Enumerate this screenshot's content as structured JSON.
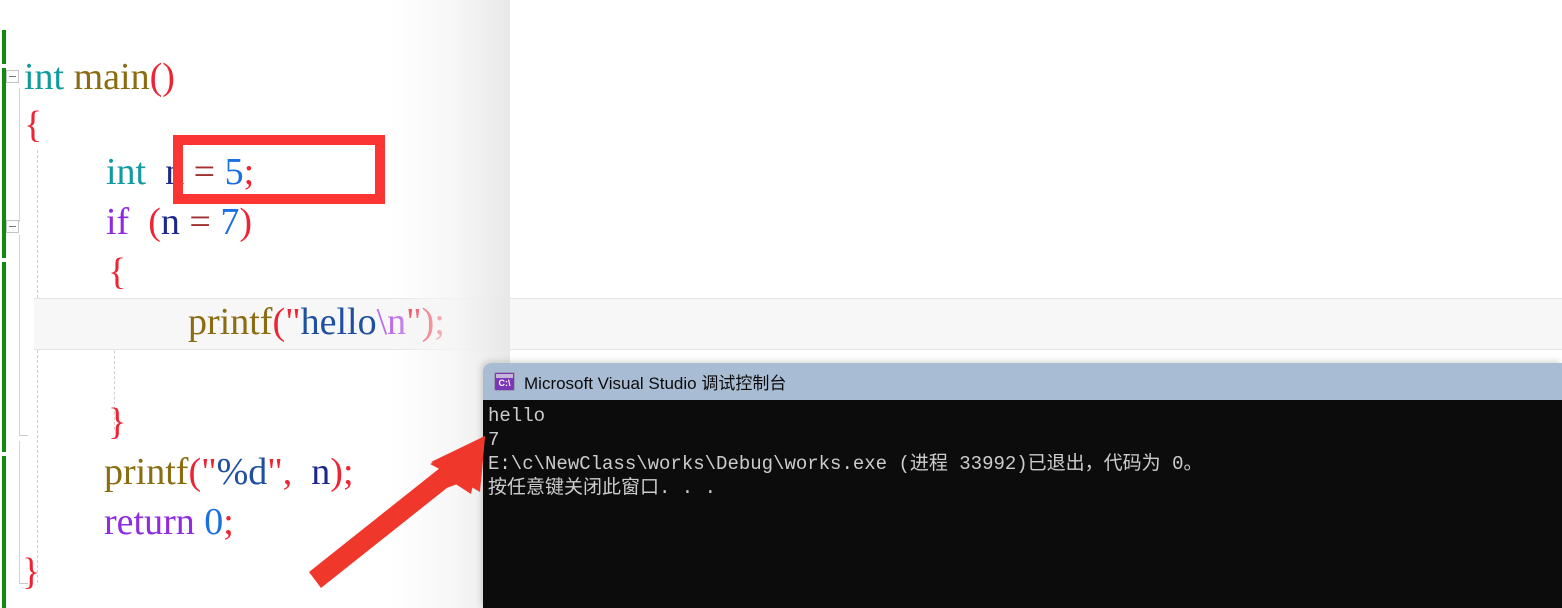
{
  "editor": {
    "language": "c",
    "lines": [
      {
        "id": "line-main",
        "text": "int main()"
      },
      {
        "id": "line-open-brace",
        "text": "{"
      },
      {
        "id": "line-decl",
        "text": "int n = 5;"
      },
      {
        "id": "line-if",
        "text": "if (n = 7)"
      },
      {
        "id": "line-if-open",
        "text": "{"
      },
      {
        "id": "line-printf-hello",
        "text": "printf(\"hello\\n\");"
      },
      {
        "id": "line-if-close",
        "text": "}"
      },
      {
        "id": "line-printf-n",
        "text": "printf(\"%d\", n);"
      },
      {
        "id": "line-return",
        "text": "return 0;"
      },
      {
        "id": "line-close-brace",
        "text": "}"
      }
    ],
    "tokens": {
      "int": "int",
      "main": "main",
      "open_paren": "(",
      "close_paren": ")",
      "open_brace": "{",
      "close_brace": "}",
      "semicolon": ";",
      "n": "n",
      "equals": "=",
      "five": "5",
      "seven": "7",
      "zero": "0",
      "if": "if",
      "return": "return",
      "printf": "printf",
      "quote": "\"",
      "hello": "hello",
      "escape_n": "\\n",
      "percent_d": "%d",
      "comma": ",",
      "space": " "
    },
    "colors": {
      "keyword_type": "#0f9ba0",
      "keyword_control": "#8f2be0",
      "function": "#8a6d12",
      "punctuation": "#ee2435",
      "identifier": "#1b2a8a",
      "number": "#1c6fe0",
      "operator": "#a03030",
      "string": "#1e4fa0",
      "escape": "#bb6ce8",
      "change_bar": "#108a10",
      "current_line_background": "#f7f7f7"
    }
  },
  "annotations": {
    "rectangle": {
      "label": "highlight-declaration",
      "color": "#fb3434",
      "target_text": "n = 5;"
    },
    "arrow": {
      "label": "points-to-console-output",
      "color": "#f0372c",
      "target_text": "7"
    }
  },
  "console": {
    "icon_name": "command-prompt-icon",
    "icon_glyph": "C:\\",
    "title": "Microsoft Visual Studio 调试控制台",
    "background": "#0c0c0c",
    "titlebar_color": "#a8bcd3",
    "output": [
      "hello",
      "7",
      "E:\\c\\NewClass\\works\\Debug\\works.exe (进程 33992)已退出，代码为 0。",
      "按任意键关闭此窗口. . ."
    ]
  }
}
